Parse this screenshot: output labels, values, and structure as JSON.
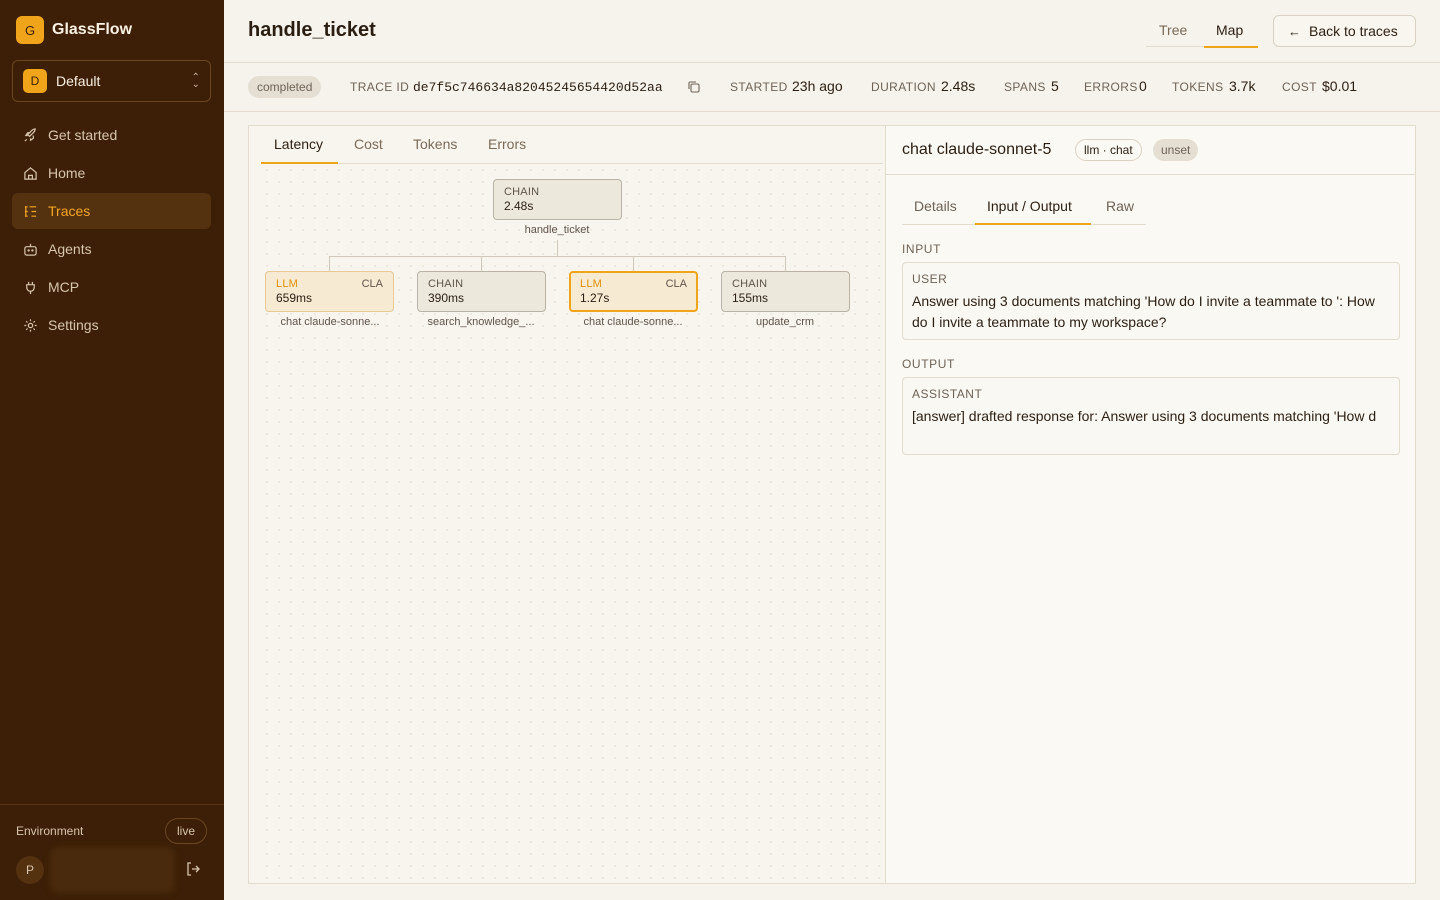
{
  "app": {
    "logo_letter": "G",
    "name": "GlassFlow"
  },
  "workspace": {
    "avatar": "D",
    "name": "Default"
  },
  "nav": [
    {
      "label": "Get started",
      "icon": "rocket-icon"
    },
    {
      "label": "Home",
      "icon": "home-icon"
    },
    {
      "label": "Traces",
      "icon": "traces-icon",
      "active": true
    },
    {
      "label": "Agents",
      "icon": "bot-icon"
    },
    {
      "label": "MCP",
      "icon": "plug-icon"
    },
    {
      "label": "Settings",
      "icon": "gear-icon"
    }
  ],
  "environment": {
    "label": "Environment",
    "value": "live"
  },
  "user": {
    "avatar": "P"
  },
  "header": {
    "title": "handle_ticket",
    "views": [
      "Tree",
      "Map"
    ],
    "active_view": "Map",
    "back_label": "Back to traces"
  },
  "meta": {
    "status": "completed",
    "trace_id_label": "TRACE ID",
    "trace_id": "de7f5c746634a82045245654420d52aa",
    "started_label": "STARTED",
    "started": "23h ago",
    "duration_label": "DURATION",
    "duration": "2.48s",
    "spans_label": "SPANS",
    "spans": "5",
    "errors_label": "ERRORS",
    "errors": "0",
    "tokens_label": "TOKENS",
    "tokens": "3.7k",
    "cost_label": "COST",
    "cost": "$0.01"
  },
  "metric_tabs": [
    "Latency",
    "Cost",
    "Tokens",
    "Errors"
  ],
  "graph": {
    "root": {
      "type": "CHAIN",
      "duration": "2.48s",
      "label": "handle_ticket"
    },
    "children": [
      {
        "type": "LLM",
        "sub": "CLA",
        "duration": "659ms",
        "label": "chat claude-sonne..."
      },
      {
        "type": "CHAIN",
        "sub": "",
        "duration": "390ms",
        "label": "search_knowledge_..."
      },
      {
        "type": "LLM",
        "sub": "CLA",
        "duration": "1.27s",
        "label": "chat claude-sonne...",
        "selected": true
      },
      {
        "type": "CHAIN",
        "sub": "",
        "duration": "155ms",
        "label": "update_crm"
      }
    ]
  },
  "detail": {
    "title": "chat claude-sonnet-5",
    "kind": "llm · chat",
    "status": "unset",
    "tabs": [
      "Details",
      "Input / Output",
      "Raw"
    ],
    "active_tab": "Input / Output",
    "input_label": "INPUT",
    "input_role": "USER",
    "input_text": "Answer using 3 documents matching 'How do I invite a teammate to ': How do I invite a teammate to my workspace?",
    "output_label": "OUTPUT",
    "output_role": "ASSISTANT",
    "output_text": "[answer] drafted response for: Answer using 3 documents matching 'How d"
  },
  "colors": {
    "accent": "#f0a41a",
    "sidebar": "#3c1f06",
    "llm_node": "#f7ead3"
  }
}
